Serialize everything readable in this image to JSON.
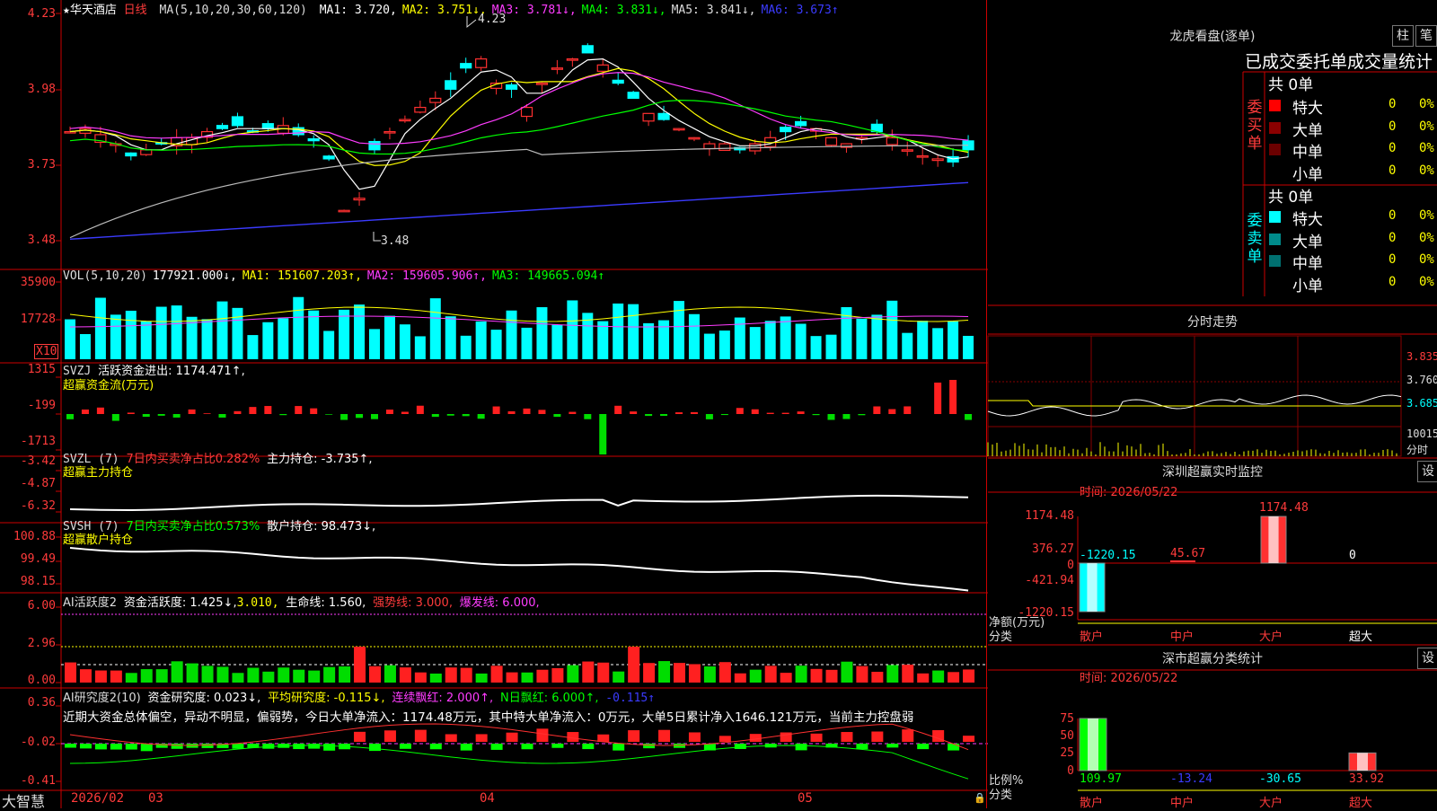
{
  "chart_title": {
    "star": "★",
    "name": "华天酒店",
    "period": "日线"
  },
  "main_ma": {
    "label": "MA(5,10,20,30,60,120)",
    "items": [
      {
        "t": "MA1: 3.720,",
        "c": "#ffffff"
      },
      {
        "t": "MA2: 3.751↓,",
        "c": "#ffff00"
      },
      {
        "t": "MA3: 3.781↓,",
        "c": "#ff3cff"
      },
      {
        "t": "MA4: 3.831↓,",
        "c": "#00ff00"
      },
      {
        "t": "MA5: 3.841↓,",
        "c": "#dddddd"
      },
      {
        "t": "MA6: 3.673↑",
        "c": "#3b3bff"
      }
    ]
  },
  "price_axis": [
    "4.23",
    "3.98",
    "3.73",
    "3.48"
  ],
  "price_high_label": "4.23",
  "price_low_label": "3.48",
  "vol_header": {
    "label": "VOL(5,10,20)",
    "items": [
      {
        "t": "177921.000↓,",
        "c": "#ffffff"
      },
      {
        "t": "MA1: 151607.203↑,",
        "c": "#ffff00"
      },
      {
        "t": "MA2: 159605.906↑,",
        "c": "#ff3cff"
      },
      {
        "t": "MA3: 149665.094↑",
        "c": "#00ff00"
      }
    ]
  },
  "vol_axis": [
    "35900",
    "17728"
  ],
  "vol_unit": "X10",
  "svzj_header": {
    "label": "SVZJ",
    "t1": "活跃资金进出: 1174.471↑,",
    "t2": "超赢资金流(万元)"
  },
  "svzj_axis": [
    "1315",
    "-199",
    "-1713"
  ],
  "svzl_header": {
    "label": "SVZL (7)",
    "t1": "7日内买卖净占比0.282%",
    "t2": "主力持仓: -3.735↑,",
    "t3": "超赢主力持仓"
  },
  "svzl_axis": [
    "-3.42",
    "-4.87",
    "-6.32"
  ],
  "svsh_header": {
    "label": "SVSH (7)",
    "t1": "7日内买卖净占比0.573%",
    "t2": "散户持仓: 98.473↓,",
    "t3": "超赢散户持仓"
  },
  "svsh_axis": [
    "100.88",
    "99.49",
    "98.15"
  ],
  "ai1_header": {
    "label": "AI活跃度2",
    "t1": "资金活跃度: 1.425↓,",
    "t2": "3.010,",
    "t3": "生命线: 1.560,",
    "t4": "强势线: 3.000,",
    "t5": "爆发线: 6.000,"
  },
  "ai1_axis": [
    "6.00",
    "2.96",
    "0.00"
  ],
  "ai2_header": {
    "label": "AI研究度2(10)",
    "t1": "资金研究度: 0.023↓,",
    "t2": "平均研究度: -0.115↓,",
    "t3": "连续飘红: 2.000↑,",
    "t4": "N日飘红: 6.000↑,",
    "t5": "-0.115↑"
  },
  "ai2_comment": "近期大资金总体偏空，异动不明显，偏弱势，今日大单净流入：1174.48万元，其中特大单净流入：0万元，大单5日累计净入1646.121万元，当前主力控盘弱",
  "ai2_axis": [
    "0.36",
    "-0.02",
    "-0.41"
  ],
  "bottom_axis": {
    "brand": "大智慧",
    "dates": [
      "2026/02",
      "03",
      "04",
      "05"
    ]
  },
  "right_top": {
    "title": "龙虎看盘(逐单)",
    "btn1": "柱",
    "btn2": "笔",
    "subtitle": "已成交委托单成交量统计",
    "buy": {
      "side": "委买单",
      "total": "共 0单",
      "rows": [
        {
          "name": "特大",
          "v": "0",
          "p": "0%",
          "color": "#ff0000"
        },
        {
          "name": "大单",
          "v": "0",
          "p": "0%",
          "color": "#8b0000"
        },
        {
          "name": "中单",
          "v": "0",
          "p": "0%",
          "color": "#6b0000"
        },
        {
          "name": "小单",
          "v": "0",
          "p": "0%",
          "color": ""
        }
      ]
    },
    "sell": {
      "side": "委卖单",
      "total": "共 0单",
      "rows": [
        {
          "name": "特大",
          "v": "0",
          "p": "0%",
          "color": "#00ffff"
        },
        {
          "name": "大单",
          "v": "0",
          "p": "0%",
          "color": "#008b8b"
        },
        {
          "name": "中单",
          "v": "0",
          "p": "0%",
          "color": "#007070"
        },
        {
          "name": "小单",
          "v": "0",
          "p": "0%",
          "color": ""
        }
      ]
    }
  },
  "intraday": {
    "title": "分时走势",
    "axis": [
      "3.835",
      "3.760",
      "3.685"
    ],
    "vol": "10015",
    "vol_label": "分时"
  },
  "sz_monitor": {
    "title": "深圳超赢实时监控",
    "btn": "设",
    "time": "时间: 2026/05/22",
    "axis": [
      "1174.48",
      "376.27",
      "0",
      "-421.94",
      "-1220.15"
    ],
    "bar_labels": [
      "-1220.15",
      "45.67",
      "1174.48",
      "0"
    ],
    "ylabel1": "净额(万元)",
    "ylabel2": "分类",
    "cats": [
      "散户",
      "中户",
      "大户",
      "超大"
    ]
  },
  "sz_class": {
    "title": "深市超赢分类统计",
    "btn": "设",
    "time": "时间: 2026/05/22",
    "axis": [
      "75",
      "50",
      "25",
      "0"
    ],
    "bar_labels": [
      "109.97",
      "-13.24",
      "-30.65",
      "33.92"
    ],
    "ylabel1": "比例%",
    "ylabel2": "分类",
    "cats": [
      "散户",
      "中户",
      "大户",
      "超大"
    ]
  },
  "chart_data": [
    {
      "type": "candlestick",
      "title": "华天酒店 日线",
      "price_range": [
        3.48,
        4.23
      ],
      "price_ticks": [
        4.23,
        3.98,
        3.73,
        3.48
      ],
      "high": 4.23,
      "low": 3.48,
      "ma": {
        "MA1": 3.72,
        "MA2": 3.751,
        "MA3": 3.781,
        "MA4": 3.831,
        "MA5": 3.841,
        "MA6": 3.673
      }
    },
    {
      "type": "bar",
      "title": "VOL(5,10,20)",
      "ticks": [
        35900,
        17728
      ],
      "latest": 177921.0,
      "MA1": 151607.203,
      "MA2": 159605.906,
      "MA3": 149665.094
    },
    {
      "type": "bar",
      "title": "深圳超赢实时监控",
      "categories": [
        "散户",
        "中户",
        "大户",
        "超大"
      ],
      "values": [
        -1220.15,
        45.67,
        1174.48,
        0
      ],
      "ylim": [
        -1220.15,
        1174.48
      ]
    },
    {
      "type": "bar",
      "title": "深市超赢分类统计",
      "categories": [
        "散户",
        "中户",
        "大户",
        "超大"
      ],
      "values": [
        109.97,
        -13.24,
        -30.65,
        33.92
      ]
    }
  ]
}
